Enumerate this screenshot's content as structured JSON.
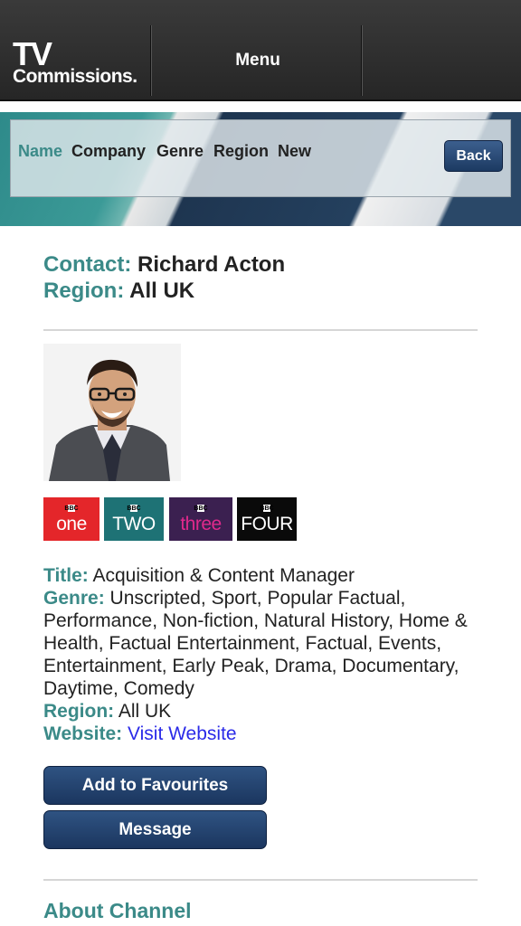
{
  "header": {
    "logo_top": "TV",
    "logo_bottom": "Commissions.",
    "menu_label": "Menu"
  },
  "sort_bar": {
    "items": [
      "Name",
      "Company",
      "Genre",
      "Region",
      "New"
    ],
    "active": "Name",
    "back_label": "Back"
  },
  "summary": {
    "contact_label": "Contact:",
    "contact_value": "Richard Acton",
    "region_label": "Region:",
    "region_value": "All UK"
  },
  "photo": {
    "icon": "person-photo"
  },
  "channels": [
    {
      "name": "one",
      "bg": "#e4262a",
      "fg": "#ffffff"
    },
    {
      "name": "TWO",
      "bg": "#1e7275",
      "fg": "#ffffff"
    },
    {
      "name": "three",
      "bg": "#3b2050",
      "fg": "#e0298c"
    },
    {
      "name": "FOUR",
      "bg": "#0a0a0a",
      "fg": "#ffffff"
    }
  ],
  "channel_prefix": "BBC",
  "details": {
    "title_label": "Title:",
    "title_value": "Acquisition & Content Manager",
    "genre_label": "Genre:",
    "genre_value": "Unscripted, Sport, Popular Factual, Performance, Non-fiction, Natural History, Home & Health, Factual Entertainment, Factual, Events, Entertainment, Early Peak, Drama, Documentary, Daytime, Comedy",
    "region_label": "Region:",
    "region_value": "All UK",
    "website_label": "Website:",
    "website_link": "Visit Website"
  },
  "actions": {
    "favourites_label": "Add to Favourites",
    "message_label": "Message"
  },
  "about_label": "About Channel",
  "colors": {
    "accent": "#3b8a88",
    "button": "#1f3c66",
    "link": "#2a2ae8"
  }
}
